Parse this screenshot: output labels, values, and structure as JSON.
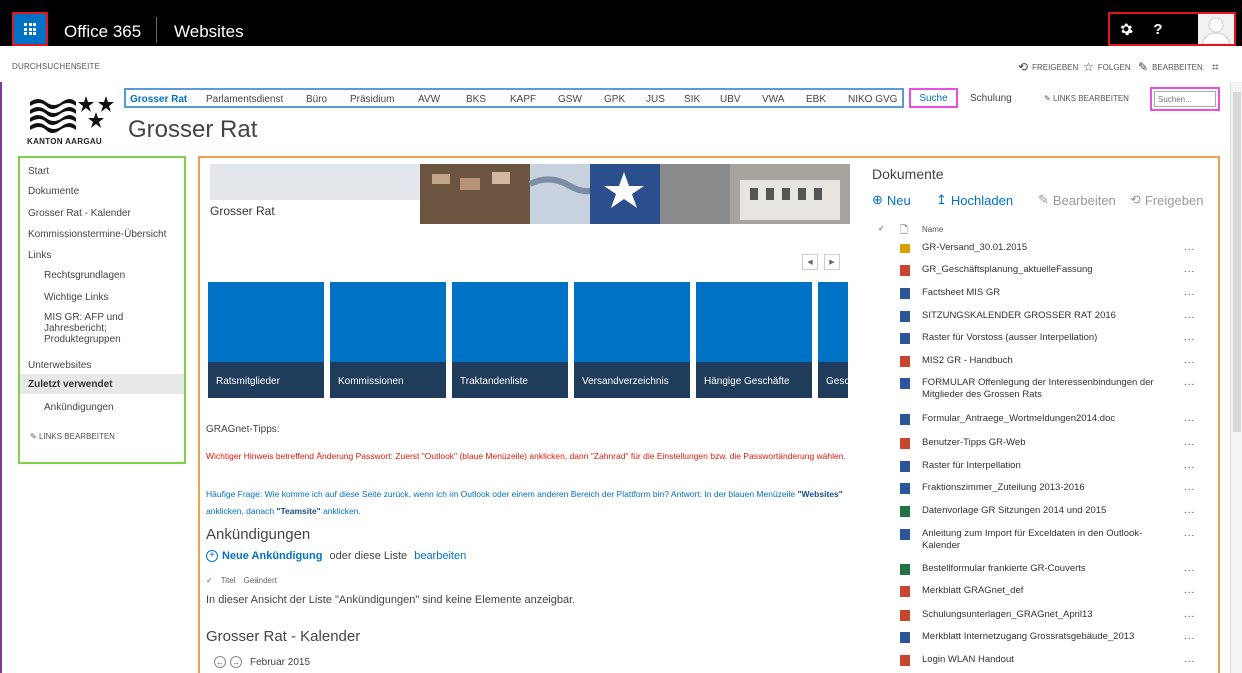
{
  "suitebar": {
    "brand": "Office 365",
    "app_title": "Websites",
    "settings_icon": "gear-icon",
    "help_label": "?"
  },
  "ribbon": {
    "tabs": [
      "DURCHSUCHEN",
      "SEITE"
    ],
    "share": "FREIGEBEN",
    "follow": "FOLGEN",
    "edit": "BEARBEITEN"
  },
  "header": {
    "logo_text": "KANTON AARGAU",
    "site_title": "Grosser Rat",
    "topnav": [
      "Grosser Rat",
      "Parlamentsdienst",
      "Büro",
      "Präsidium",
      "AVW",
      "BKS",
      "KAPF",
      "GSW",
      "GPK",
      "JUS",
      "SIK",
      "UBV",
      "VWA",
      "EBK",
      "NIKO GVG"
    ],
    "suche": "Suche",
    "schulung": "Schulung",
    "links_edit": "LINKS BEARBEITEN",
    "search_placeholder": "Suchen..."
  },
  "leftnav": {
    "items": [
      "Start",
      "Dokumente",
      "Grosser Rat - Kalender",
      "Kommissionstermine-Übersicht",
      "Links"
    ],
    "links_sub": [
      "Rechtsgrundlagen",
      "Wichtige Links",
      "MIS GR: AFP und Jahresbericht; Produktegruppen"
    ],
    "subsites": "Unterwebsites",
    "recent": "Zuletzt verwendet",
    "recent_sub": [
      "Ankündigungen"
    ],
    "links_edit": "LINKS BEARBEITEN"
  },
  "main": {
    "banner_title": "Grosser Rat",
    "tiles": [
      "Ratsmitglieder",
      "Kommissionen",
      "Traktandenliste",
      "Versandverzeichnis",
      "Hängige Geschäfte",
      "Gesc"
    ],
    "tips_title": "GRAGnet-Tipps:",
    "tip_red": "Wichtiger Hinweis betreffend Änderung Passwort: Zuerst \"Outlook\" (blaue Menüzeile) anklicken, dann \"Zahnrad\" für die Einstellungen bzw. die Passwortänderung wählen.",
    "tip_blue_pre": "Häufige Frage: Wie komme ich auf diese Seite zurück, wenn ich im Outlook oder einem anderen Bereich der Plattform bin? Antwort: In der blauen Menüzeile ",
    "tip_blue_websites": "\"Websites\"",
    "tip_blue_mid": " anklicken, danach ",
    "tip_blue_teamsite": "\"Teamsite\"",
    "tip_blue_post": " anklicken.",
    "announcements_title": "Ankündigungen",
    "new_ann": "Neue Ankündigung",
    "new_ann_mid": " oder diese Liste ",
    "new_ann_edit": "bearbeiten",
    "col_title": "Titel",
    "col_changed": "Geändert",
    "empty_msg": "In dieser Ansicht der Liste \"Ankündigungen\" sind keine Elemente anzeigbar.",
    "calendar_title": "Grosser Rat - Kalender",
    "calendar_month": "Februar 2015"
  },
  "documents": {
    "title": "Dokumente",
    "new": "Neu",
    "upload": "Hochladen",
    "edit": "Bearbeiten",
    "share": "Freigeben",
    "col_name": "Name",
    "items": [
      {
        "name": "GR-Versand_30.01.2015",
        "type": "folder"
      },
      {
        "name": "GR_Geschäftsplanung_aktuelleFassung",
        "type": "pdf"
      },
      {
        "name": "Factsheet MIS GR",
        "type": "word"
      },
      {
        "name": "SITZUNGSKALENDER GROSSER RAT 2016",
        "type": "word"
      },
      {
        "name": "Raster für Vorstoss (ausser Interpellation)",
        "type": "word"
      },
      {
        "name": "MIS2 GR - Handbuch",
        "type": "pdf"
      },
      {
        "name": "FORMULAR Offenlegung der Interessenbindungen der Mitglieder des Grossen Rats",
        "type": "word"
      },
      {
        "name": "Formular_Antraege_Wortmeldungen2014.doc",
        "type": "word"
      },
      {
        "name": "Benutzer-Tipps GR-Web",
        "type": "pdf"
      },
      {
        "name": "Raster für Interpellation",
        "type": "word"
      },
      {
        "name": "Fraktionszimmer_Zuteilung 2013-2016",
        "type": "word"
      },
      {
        "name": "Datenvorlage GR Sitzungen 2014 und 2015",
        "type": "excel"
      },
      {
        "name": "Anleitung zum Import für Exceldaten in den Outlook-Kalender",
        "type": "word"
      },
      {
        "name": "Bestellformular frankierte GR-Couverts",
        "type": "excel"
      },
      {
        "name": "Merkblatt GRAGnet_def",
        "type": "pdf"
      },
      {
        "name": "Schulungsunterlagen_GRAGnet_April13",
        "type": "pdf"
      },
      {
        "name": "Merkblatt Internetzugang Grossratsgebäude_2013",
        "type": "word"
      },
      {
        "name": "Login WLAN Handout",
        "type": "pdf"
      }
    ],
    "more": "..."
  }
}
